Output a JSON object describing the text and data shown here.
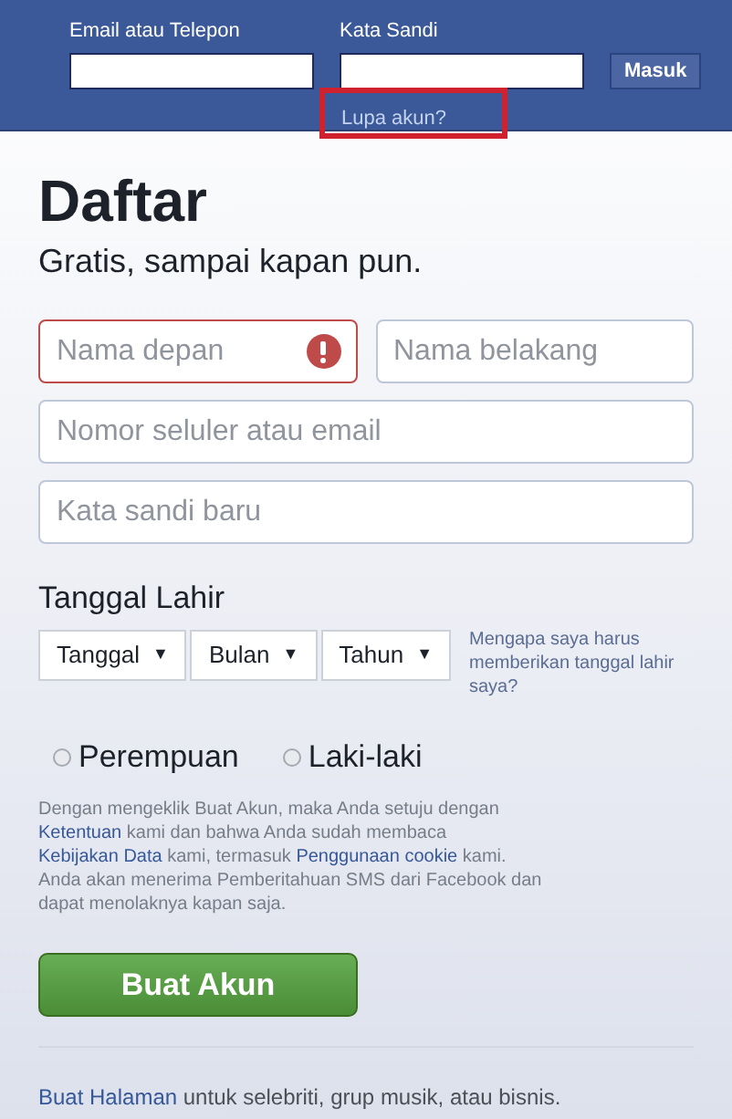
{
  "header": {
    "email_label": "Email atau Telepon",
    "password_label": "Kata Sandi",
    "login_button": "Masuk",
    "forgot_link": "Lupa akun?",
    "forgot_highlighted": true
  },
  "title": "Daftar",
  "subtitle": "Gratis, sampai kapan pun.",
  "fields": [
    [
      {
        "placeholder": "Nama depan",
        "error": true
      },
      {
        "placeholder": "Nama belakang",
        "error": false
      }
    ],
    [
      {
        "placeholder": "Nomor seluler atau email",
        "error": false
      }
    ],
    [
      {
        "placeholder": "Kata sandi baru",
        "error": false
      }
    ]
  ],
  "birthday": {
    "label": "Tanggal Lahir",
    "selects": [
      {
        "value": "Tanggal",
        "arrow": "▼"
      },
      {
        "value": "Bulan",
        "arrow": "▼"
      },
      {
        "value": "Tahun",
        "arrow": "▼"
      }
    ],
    "help_link": "Mengapa saya harus memberikan tanggal lahir saya?"
  },
  "gender": [
    {
      "label": "Perempuan",
      "selected": false
    },
    {
      "label": "Laki-laki",
      "selected": false
    }
  ],
  "terms": [
    {
      "kind": "plain",
      "text": "Dengan mengeklik Buat Akun, maka Anda setuju dengan "
    },
    {
      "kind": "link",
      "text": "Ketentuan"
    },
    {
      "kind": "plain",
      "text": " kami dan bahwa Anda sudah membaca "
    },
    {
      "kind": "link",
      "text": "Kebijakan Data"
    },
    {
      "kind": "plain",
      "text": " kami, termasuk "
    },
    {
      "kind": "link",
      "text": "Penggunaan cookie"
    },
    {
      "kind": "plain",
      "text": " kami. Anda akan menerima Pemberitahuan SMS dari Facebook dan dapat menolaknya kapan saja."
    }
  ],
  "submit_button": "Buat Akun",
  "footer": [
    {
      "kind": "link",
      "text": "Buat Halaman"
    },
    {
      "kind": "plain",
      "text": " untuk selebriti, grup musik, atau bisnis."
    }
  ]
}
